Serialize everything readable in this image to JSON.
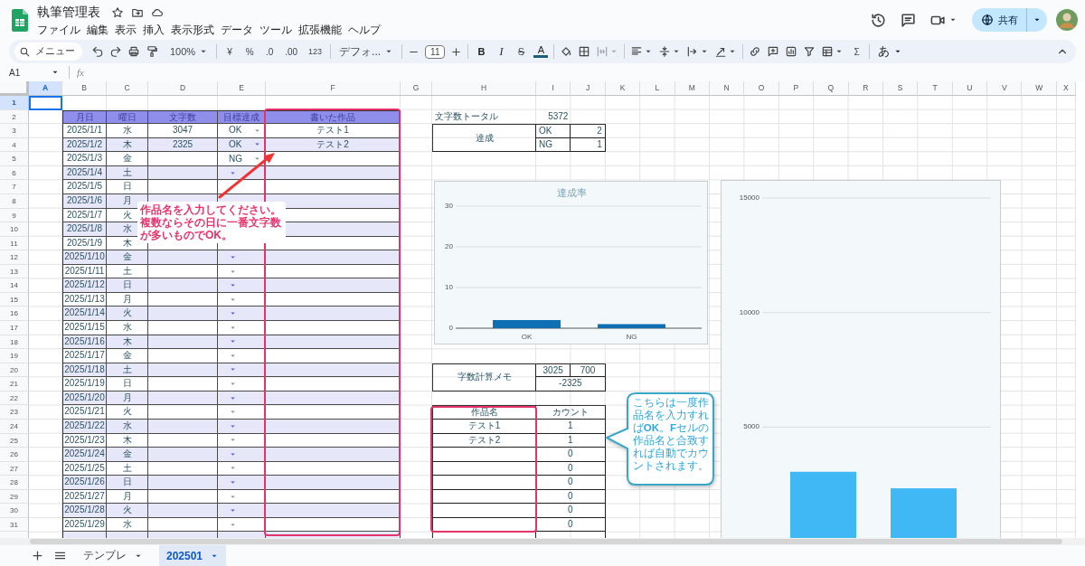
{
  "window": {
    "title": "執筆管理表"
  },
  "menu": [
    "ファイル",
    "編集",
    "表示",
    "挿入",
    "表示形式",
    "データ",
    "ツール",
    "拡張機能",
    "ヘルプ"
  ],
  "share_button": {
    "label": "共有"
  },
  "toolbar": {
    "search": "メニュー",
    "zoom": "100%",
    "currency": "¥",
    "percent": "%",
    "decrease_decimal": ".0",
    "increase_decimal": ".00",
    "number_format": "123",
    "font": "デフォ...",
    "font_size": "11",
    "bold": "B",
    "italic": "I",
    "strikethrough": "S",
    "text_color": "A",
    "sum": "Σ",
    "input_tool": "あ"
  },
  "formula_bar": {
    "cell_ref": "A1",
    "fx": "fx"
  },
  "sheet": {
    "columns": [
      {
        "label": "A",
        "selected": true
      },
      {
        "label": "B",
        "selected": false
      },
      {
        "label": "C",
        "selected": false
      },
      {
        "label": "D",
        "selected": false
      },
      {
        "label": "E",
        "selected": false
      },
      {
        "label": "F",
        "selected": false
      },
      {
        "label": "G",
        "selected": false
      },
      {
        "label": "H",
        "selected": false
      },
      {
        "label": "I",
        "selected": false
      },
      {
        "label": "J",
        "selected": false
      },
      {
        "label": "K",
        "selected": false
      },
      {
        "label": "L",
        "selected": false
      },
      {
        "label": "M",
        "selected": false
      },
      {
        "label": "N",
        "selected": false
      },
      {
        "label": "O",
        "selected": false
      },
      {
        "label": "P",
        "selected": false
      },
      {
        "label": "Q",
        "selected": false
      },
      {
        "label": "R",
        "selected": false
      },
      {
        "label": "S",
        "selected": false
      },
      {
        "label": "T",
        "selected": false
      },
      {
        "label": "U",
        "selected": false
      },
      {
        "label": "V",
        "selected": false
      },
      {
        "label": "W",
        "selected": false
      },
      {
        "label": "X",
        "selected": false
      }
    ],
    "rows": [
      {
        "label": "1",
        "selected": true
      },
      {
        "label": "2",
        "selected": false
      },
      {
        "label": "3",
        "selected": false
      },
      {
        "label": "4",
        "selected": false
      },
      {
        "label": "5",
        "selected": false
      },
      {
        "label": "6",
        "selected": false
      },
      {
        "label": "7",
        "selected": false
      },
      {
        "label": "8",
        "selected": false
      },
      {
        "label": "9",
        "selected": false
      },
      {
        "label": "10",
        "selected": false
      },
      {
        "label": "11",
        "selected": false
      },
      {
        "label": "12",
        "selected": false
      },
      {
        "label": "13",
        "selected": false
      },
      {
        "label": "14",
        "selected": false
      },
      {
        "label": "15",
        "selected": false
      },
      {
        "label": "16",
        "selected": false
      },
      {
        "label": "17",
        "selected": false
      },
      {
        "label": "18",
        "selected": false
      },
      {
        "label": "19",
        "selected": false
      },
      {
        "label": "20",
        "selected": false
      },
      {
        "label": "21",
        "selected": false
      },
      {
        "label": "22",
        "selected": false
      },
      {
        "label": "23",
        "selected": false
      },
      {
        "label": "24",
        "selected": false
      },
      {
        "label": "25",
        "selected": false
      },
      {
        "label": "26",
        "selected": false
      },
      {
        "label": "27",
        "selected": false
      },
      {
        "label": "28",
        "selected": false
      },
      {
        "label": "29",
        "selected": false
      },
      {
        "label": "30",
        "selected": false
      },
      {
        "label": "31",
        "selected": false
      }
    ],
    "log_table": {
      "header": [
        "月日",
        "曜日",
        "文字数",
        "目標達成",
        "書いた作品"
      ],
      "rows": [
        {
          "date": "2025/1/1",
          "weekday": "水",
          "chars": "3047",
          "goal": "OK",
          "work": "テスト1"
        },
        {
          "date": "2025/1/2",
          "weekday": "木",
          "chars": "2325",
          "goal": "OK",
          "work": "テスト2"
        },
        {
          "date": "2025/1/3",
          "weekday": "金",
          "goal": "NG"
        },
        {
          "date": "2025/1/4",
          "weekday": "土"
        },
        {
          "date": "2025/1/5",
          "weekday": "日"
        },
        {
          "date": "2025/1/6",
          "weekday": "月"
        },
        {
          "date": "2025/1/7",
          "weekday": "火"
        },
        {
          "date": "2025/1/8",
          "weekday": "水"
        },
        {
          "date": "2025/1/9",
          "weekday": "木"
        },
        {
          "date": "2025/1/10",
          "weekday": "金"
        },
        {
          "date": "2025/1/11",
          "weekday": "土"
        },
        {
          "date": "2025/1/12",
          "weekday": "日"
        },
        {
          "date": "2025/1/13",
          "weekday": "月"
        },
        {
          "date": "2025/1/14",
          "weekday": "火"
        },
        {
          "date": "2025/1/15",
          "weekday": "水"
        },
        {
          "date": "2025/1/16",
          "weekday": "木"
        },
        {
          "date": "2025/1/17",
          "weekday": "金"
        },
        {
          "date": "2025/1/18",
          "weekday": "土"
        },
        {
          "date": "2025/1/19",
          "weekday": "日"
        },
        {
          "date": "2025/1/20",
          "weekday": "月"
        },
        {
          "date": "2025/1/21",
          "weekday": "火"
        },
        {
          "date": "2025/1/22",
          "weekday": "水"
        },
        {
          "date": "2025/1/23",
          "weekday": "木"
        },
        {
          "date": "2025/1/24",
          "weekday": "金"
        },
        {
          "date": "2025/1/25",
          "weekday": "土"
        },
        {
          "date": "2025/1/26",
          "weekday": "日"
        },
        {
          "date": "2025/1/27",
          "weekday": "月"
        },
        {
          "date": "2025/1/28",
          "weekday": "火"
        },
        {
          "date": "2025/1/29",
          "weekday": "水"
        }
      ]
    },
    "total": {
      "label": "文字数トータル",
      "value": "5372"
    },
    "achievement": {
      "label": "達成",
      "items": [
        {
          "label": "OK",
          "value": "2"
        },
        {
          "label": "NG",
          "value": "1"
        }
      ]
    },
    "memo": {
      "label": "字数計算メモ",
      "values": [
        "3025",
        "700"
      ],
      "result": "-2325"
    },
    "works_table": {
      "header": [
        "作品名",
        "カウント"
      ],
      "rows": [
        {
          "name": "テスト1",
          "count": "1"
        },
        {
          "name": "テスト2",
          "count": "1"
        },
        {
          "count": "0"
        },
        {
          "count": "0"
        },
        {
          "count": "0"
        },
        {
          "count": "0"
        },
        {
          "count": "0"
        },
        {
          "count": "0"
        }
      ]
    },
    "charts": [
      {
        "chart_data": {
          "type": "bar",
          "title": "達成率",
          "categories": [
            "OK",
            "NG"
          ],
          "values": [
            2,
            1
          ],
          "ylim": [
            0,
            30
          ],
          "yticks": [
            0,
            10,
            20,
            30
          ]
        }
      },
      {
        "chart_data": {
          "type": "bar",
          "values": [
            3047,
            2325
          ],
          "ylim": [
            0,
            15000
          ],
          "yticks": [
            5000,
            10000,
            15000
          ]
        }
      }
    ],
    "notes": [
      {
        "kind": "highlight"
      },
      {
        "kind": "highlight"
      },
      {
        "kind": "arrow_note",
        "text": "作品名を入力してください。複数ならその日に一番文字数が多いものでOK。"
      },
      {
        "kind": "speech_bubble",
        "text": "こちらは一度作品名を入力すれば**OK**。**F**セルの作品名と合致すれば自動でカウントされます。"
      }
    ]
  },
  "sheet_tabs": [
    {
      "label": "テンプレ",
      "selected": false
    },
    {
      "label": "202501",
      "selected": true
    }
  ]
}
